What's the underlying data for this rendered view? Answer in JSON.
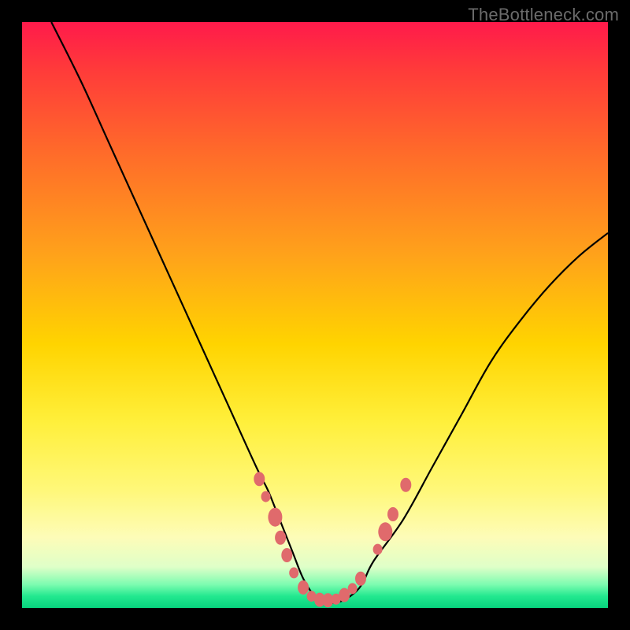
{
  "attribution": "TheBottleneck.com",
  "chart_data": {
    "type": "line",
    "title": "",
    "xlabel": "",
    "ylabel": "",
    "xlim": [
      0,
      100
    ],
    "ylim": [
      0,
      100
    ],
    "series": [
      {
        "name": "bottleneck-curve",
        "x": [
          5,
          10,
          15,
          20,
          25,
          30,
          35,
          40,
          42,
          44,
          46,
          48,
          50,
          52,
          54,
          56,
          58,
          60,
          65,
          70,
          75,
          80,
          85,
          90,
          95,
          100
        ],
        "y": [
          100,
          90,
          79,
          68,
          57,
          46,
          35,
          24,
          20,
          15,
          10,
          5,
          2,
          1,
          1,
          2,
          4,
          8,
          15,
          24,
          33,
          42,
          49,
          55,
          60,
          64
        ]
      }
    ],
    "markers": {
      "name": "highlight-dots",
      "color": "#e06a6c",
      "points": [
        {
          "x": 40.5,
          "y": 22,
          "size": "md"
        },
        {
          "x": 41.6,
          "y": 19,
          "size": "sm"
        },
        {
          "x": 43.2,
          "y": 15.5,
          "size": "lg"
        },
        {
          "x": 44.1,
          "y": 12,
          "size": "md"
        },
        {
          "x": 45.2,
          "y": 9,
          "size": "md"
        },
        {
          "x": 46.4,
          "y": 6,
          "size": "sm"
        },
        {
          "x": 48.0,
          "y": 3.5,
          "size": "md"
        },
        {
          "x": 49.4,
          "y": 2.0,
          "size": "sm"
        },
        {
          "x": 50.8,
          "y": 1.4,
          "size": "md"
        },
        {
          "x": 52.2,
          "y": 1.3,
          "size": "md"
        },
        {
          "x": 53.6,
          "y": 1.5,
          "size": "sm"
        },
        {
          "x": 55.0,
          "y": 2.2,
          "size": "md"
        },
        {
          "x": 56.4,
          "y": 3.3,
          "size": "sm"
        },
        {
          "x": 57.8,
          "y": 5.0,
          "size": "md"
        },
        {
          "x": 60.7,
          "y": 10,
          "size": "sm"
        },
        {
          "x": 62.0,
          "y": 13,
          "size": "lg"
        },
        {
          "x": 63.3,
          "y": 16,
          "size": "md"
        },
        {
          "x": 65.5,
          "y": 21,
          "size": "md"
        }
      ]
    },
    "gradient_stops": [
      {
        "pos": 0,
        "color": "#ff1a4b"
      },
      {
        "pos": 8,
        "color": "#ff3a3a"
      },
      {
        "pos": 22,
        "color": "#ff6a2a"
      },
      {
        "pos": 40,
        "color": "#ffa31a"
      },
      {
        "pos": 55,
        "color": "#ffd400"
      },
      {
        "pos": 68,
        "color": "#ffef3a"
      },
      {
        "pos": 80,
        "color": "#fff87a"
      },
      {
        "pos": 88,
        "color": "#fdfcb8"
      },
      {
        "pos": 93,
        "color": "#dfffc8"
      },
      {
        "pos": 96,
        "color": "#7dfcb0"
      },
      {
        "pos": 98,
        "color": "#22e88f"
      },
      {
        "pos": 100,
        "color": "#07d47e"
      }
    ]
  }
}
